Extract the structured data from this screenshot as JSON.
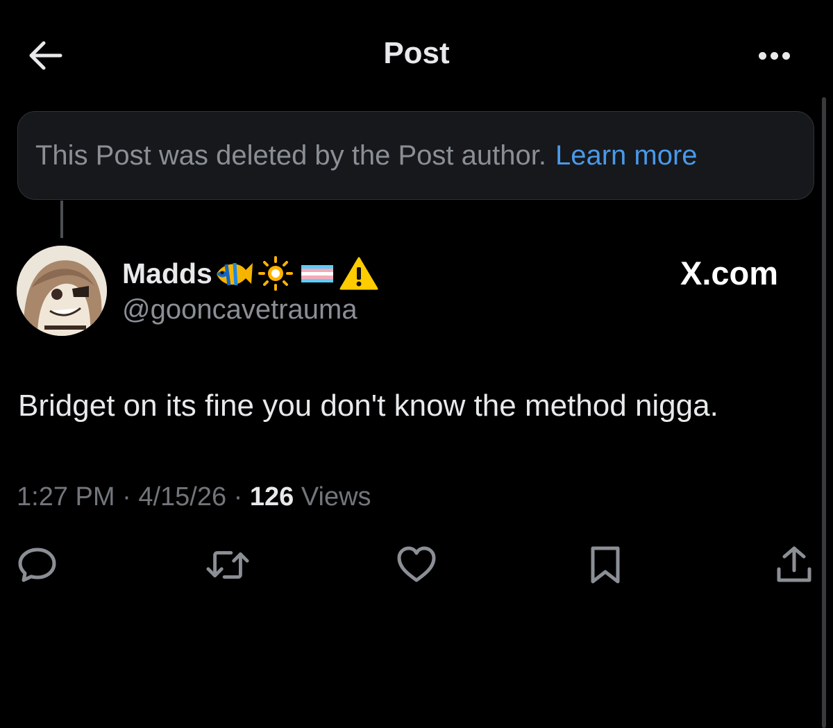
{
  "header": {
    "title": "Post",
    "back_icon": "arrow-left-icon",
    "more_icon": "more-horizontal-icon"
  },
  "notice": {
    "text": "This Post was deleted by the Post author.",
    "link": "Learn more"
  },
  "author": {
    "display_name": "Madds",
    "badges": [
      "tropical-fish-emoji",
      "sun-emoji",
      "transgender-flag-emoji",
      "warning-emoji"
    ],
    "handle": "@gooncavetrauma"
  },
  "watermark": "X.com",
  "post": {
    "text": "Bridget on its fine you don't know the method nigga."
  },
  "meta": {
    "time": "1:27 PM",
    "date": "4/15/26",
    "views_count": "126",
    "views_label": "Views",
    "separator": "·"
  },
  "actions": [
    "reply-icon",
    "repost-icon",
    "like-icon",
    "bookmark-icon",
    "share-icon"
  ],
  "colors": {
    "background": "#000000",
    "text_primary": "#e7e9ea",
    "text_secondary": "#8b8f95",
    "link": "#4a99e9",
    "notice_bg": "#16181c",
    "border": "#2f3336"
  }
}
